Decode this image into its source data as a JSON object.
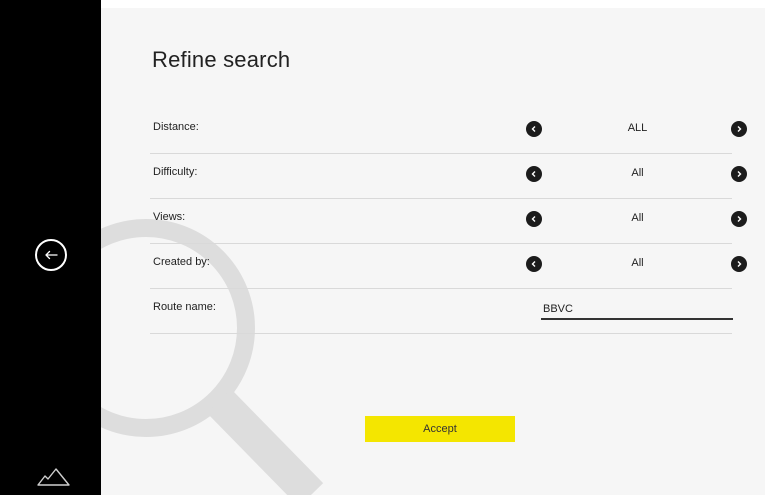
{
  "page": {
    "title": "Refine search"
  },
  "sidebar": {
    "back_icon": "arrow-left-icon",
    "logo_icon": "mountain-logo-icon"
  },
  "filters": [
    {
      "label": "Distance:",
      "value": "ALL"
    },
    {
      "label": "Difficulty:",
      "value": "All"
    },
    {
      "label": "Views:",
      "value": "All"
    },
    {
      "label": "Created by:",
      "value": "All"
    }
  ],
  "route_name": {
    "label": "Route name:",
    "value": "BBVC"
  },
  "accept_label": "Accept",
  "colors": {
    "sidebar": "#000000",
    "background": "#f6f6f6",
    "accent": "#f4e600",
    "arrow_button": "#1c1c1c",
    "divider": "#d9d9d9",
    "watermark": "#dddddd"
  }
}
